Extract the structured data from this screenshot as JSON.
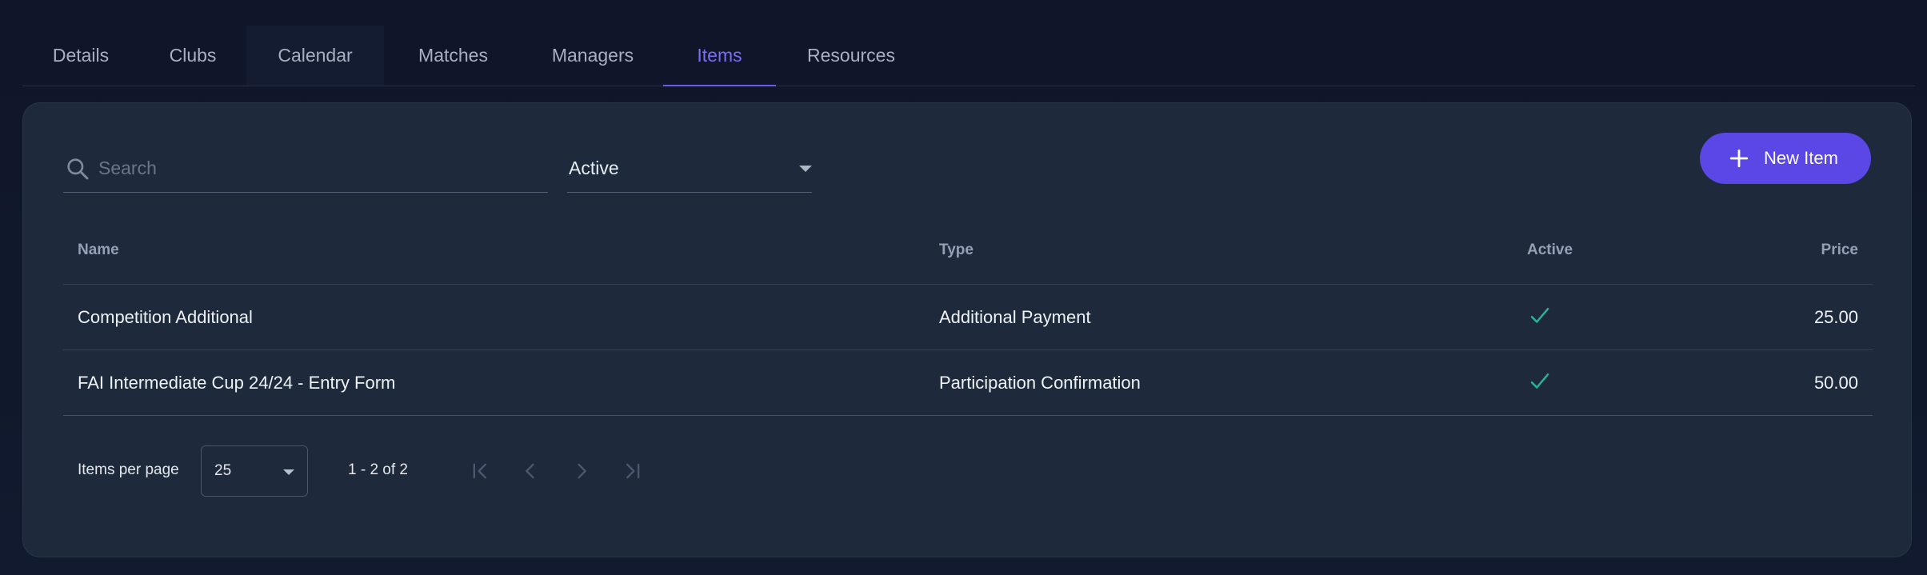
{
  "tabs": [
    {
      "label": "Details"
    },
    {
      "label": "Clubs"
    },
    {
      "label": "Calendar"
    },
    {
      "label": "Matches"
    },
    {
      "label": "Managers"
    },
    {
      "label": "Items",
      "active": true
    },
    {
      "label": "Resources"
    }
  ],
  "toolbar": {
    "search_placeholder": "Search",
    "search_value": "",
    "status_filter": "Active",
    "new_button_label": "New Item"
  },
  "table": {
    "headers": {
      "name": "Name",
      "type": "Type",
      "active": "Active",
      "price": "Price"
    },
    "rows": [
      {
        "name": "Competition Additional",
        "type": "Additional Payment",
        "active": true,
        "price": "25.00"
      },
      {
        "name": "FAI Intermediate Cup 24/24 - Entry Form",
        "type": "Participation Confirmation",
        "active": true,
        "price": "50.00"
      }
    ]
  },
  "pagination": {
    "items_per_page_label": "Items per page",
    "items_per_page": "25",
    "range": "1 - 2 of 2"
  },
  "colors": {
    "accent": "#5a47e6",
    "active_tab": "#7c6cf6",
    "check": "#2bb39a",
    "card_bg": "#1e293b",
    "page_bg": "#0f172a"
  },
  "icons": {
    "search": "search-icon",
    "plus": "plus-icon",
    "check": "check-icon",
    "first": "first-page-icon",
    "prev": "chevron-left-icon",
    "next": "chevron-right-icon",
    "last": "last-page-icon"
  }
}
